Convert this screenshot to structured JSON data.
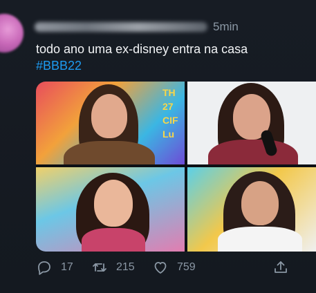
{
  "tweet": {
    "time": "5min",
    "text": "todo ano uma ex-disney entra na casa",
    "hashtag": "#BBB22",
    "media": {
      "photo1_text": [
        "TH",
        "27",
        "CIF",
        "Lu"
      ]
    }
  },
  "actions": {
    "reply_count": "17",
    "retweet_count": "215",
    "like_count": "759"
  },
  "colors": {
    "background": "#151a21",
    "text": "#f2f4f6",
    "secondary": "#8b98a5",
    "link": "#1d9bf0"
  },
  "icons": [
    "reply-icon",
    "retweet-icon",
    "like-icon",
    "share-icon"
  ]
}
